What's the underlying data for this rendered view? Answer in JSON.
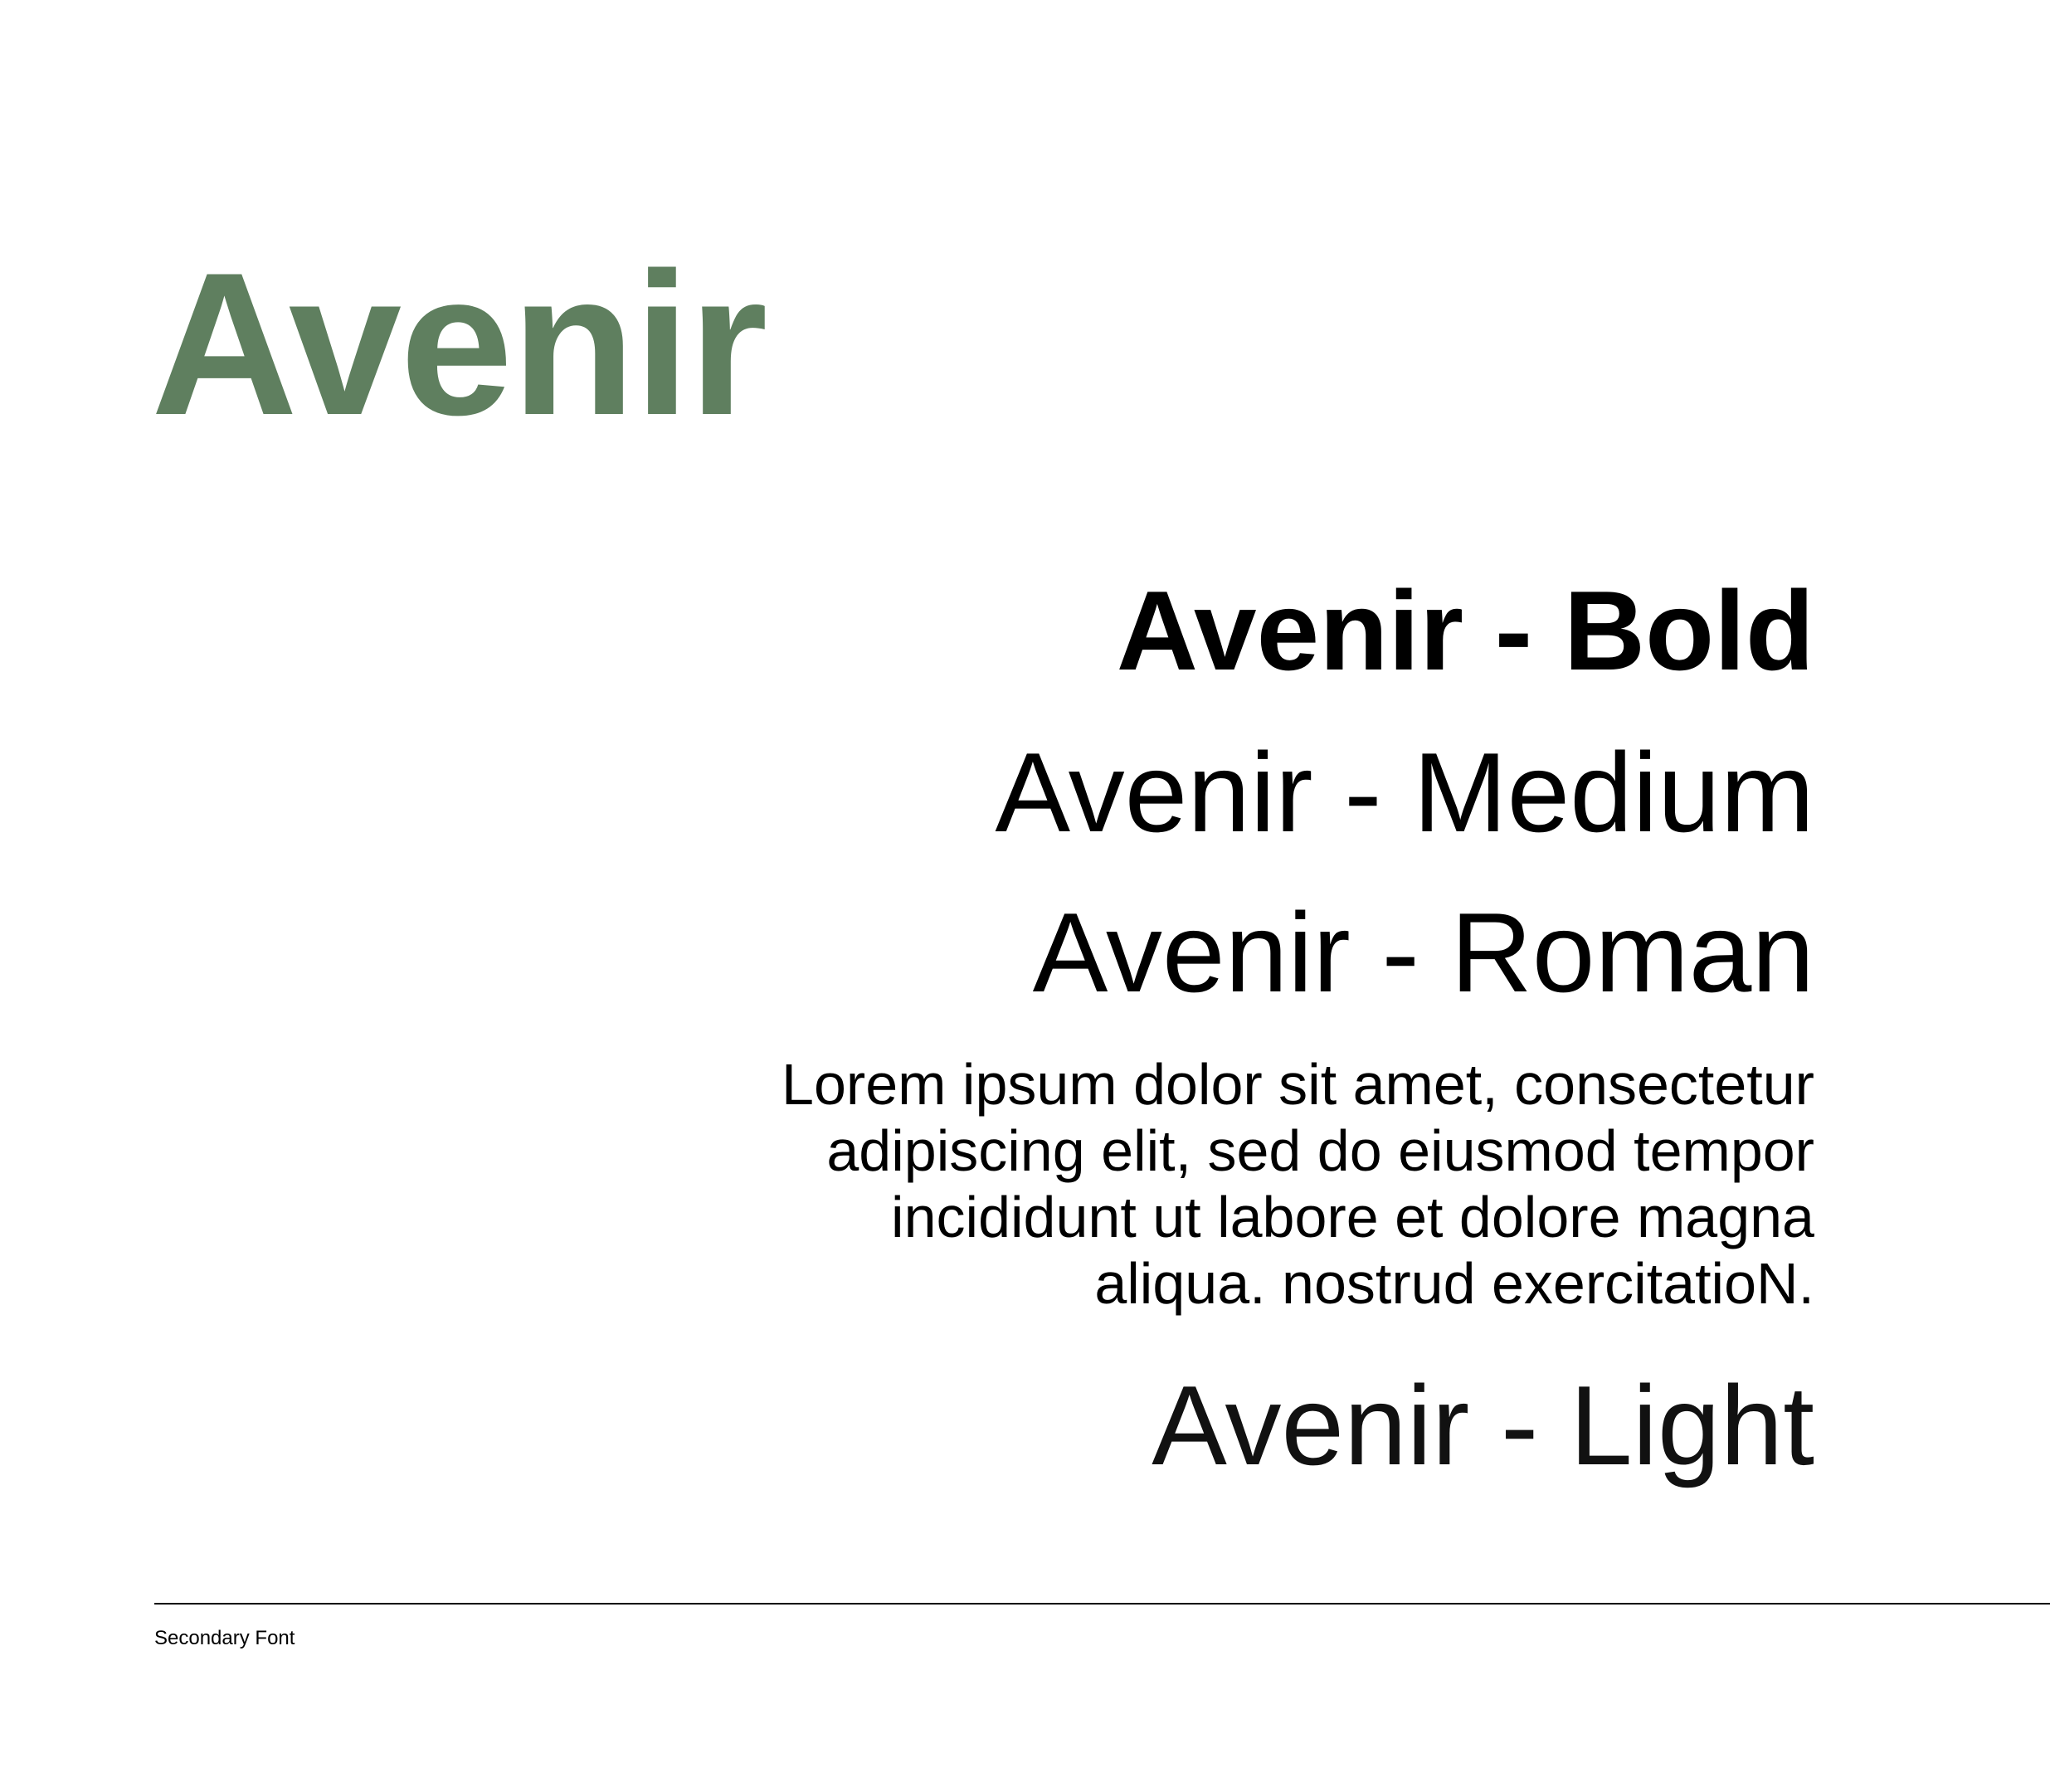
{
  "title": "Avenir",
  "accent_color": "#5f7f5f",
  "weights": {
    "bold": "Avenir - Bold",
    "medium": "Avenir - Medium",
    "roman": "Avenir - Roman",
    "light": "Avenir - Light"
  },
  "sample_text": [
    "Lorem ipsum dolor sit amet, consectetur",
    "adipiscing elit, sed do eiusmod tempor",
    "incididunt ut labore et dolore magna",
    "aliqua. nostrud exercitatioN."
  ],
  "footer": "Secondary Font"
}
